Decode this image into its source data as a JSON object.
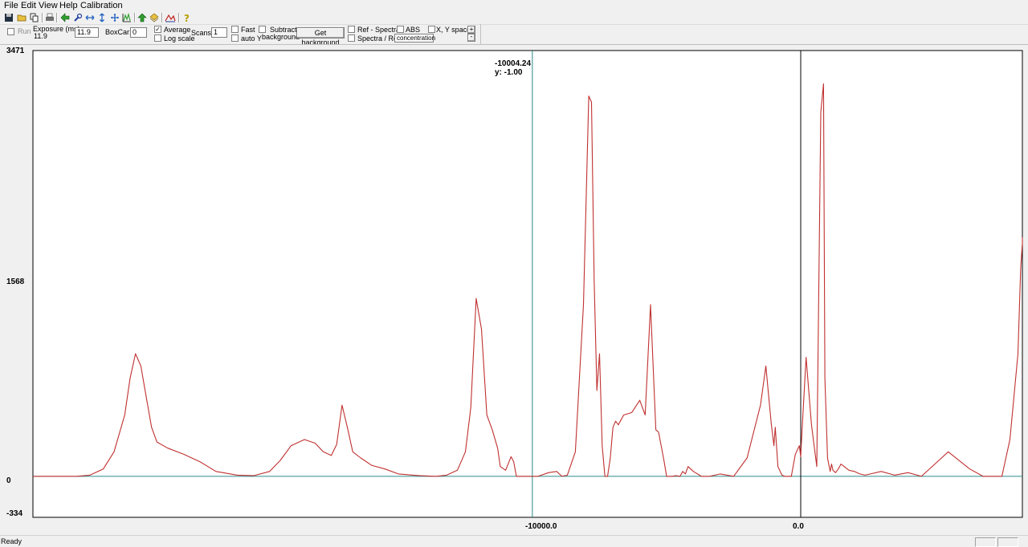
{
  "menubar": {
    "items": [
      "File",
      "Edit",
      "View",
      "Help",
      "Calibration"
    ]
  },
  "toolbar": {
    "icons": [
      "save-icon",
      "open-folder-icon",
      "copy-icon",
      "print-icon",
      "back-arrow-icon",
      "wrench-icon",
      "horizontal-arrows-icon",
      "vertical-arrows-icon",
      "move-icon",
      "peak-chart-icon",
      "up-arrow-icon",
      "stack-icon",
      "spectrum-icon",
      "help-icon"
    ]
  },
  "controls": {
    "run_label": "Run",
    "exposure_label": "Exposure (ms):",
    "exposure_readout": "11.9",
    "exposure_value": "11.9",
    "boxcar_label": "BoxCar:",
    "boxcar_value": "0",
    "average_label": "Average",
    "logscale_label": "Log scale",
    "scans_label": "Scans:",
    "scans_value": "1",
    "fast_label": "Fast",
    "autoy_label": "auto Y",
    "subtract_label": "Subtract",
    "background_label": "background",
    "get_background_label": "Get background",
    "ref_spectra_label": "Ref - Spectra",
    "spectra_ref_label": "Spectra / Ref",
    "abs_label": "ABS",
    "concentration_label": "concentration",
    "xy_space_label": "X, Y space",
    "plus_label": "+",
    "minus_label": "-"
  },
  "plot": {
    "readout_x": "-10004.24",
    "readout_y": "y: -1.00",
    "y_ticks": [
      "3471",
      "1568",
      "0",
      "-334"
    ],
    "x_ticks": [
      "-10000.0",
      "0.0"
    ],
    "curve_color": "#c03030",
    "baseline_color": "#2a8a8a",
    "cursor_color": "#2a8a8a",
    "axis_color": "#000000"
  },
  "chart_data": {
    "type": "line",
    "title": "",
    "xlabel": "",
    "ylabel": "",
    "ylim": [
      -334,
      3471
    ],
    "y_ticks": [
      3471,
      1568,
      0,
      -334
    ],
    "x_ticks": [
      -10000.0,
      0.0
    ],
    "cursor": {
      "x": -10004.24,
      "y": -1.0
    },
    "series": [
      {
        "x": [
          -28700,
          -28000,
          -27000,
          -26500,
          -26000,
          -25600,
          -25200,
          -25000,
          -24800,
          -24600,
          -24400,
          -24200,
          -24000,
          -23600,
          -23000,
          -22400,
          -21800,
          -21000,
          -20400,
          -19800,
          -19400,
          -19000,
          -18500,
          -18100,
          -17800,
          -17500,
          -17300,
          -17100,
          -16900,
          -16700,
          -16400,
          -16000,
          -15500,
          -15000,
          -14200,
          -13600,
          -13200,
          -12800,
          -12500,
          -12300,
          -12100,
          -11900,
          -11700,
          -11500,
          -11300,
          -11200,
          -11000,
          -10800,
          -10700,
          -10600,
          -10400,
          -10300,
          -10200,
          -9800,
          -9400,
          -9100,
          -8900,
          -8700,
          -8400,
          -8100,
          -7900,
          -7800,
          -7700,
          -7600,
          -7500,
          -7400,
          -7300,
          -7200,
          -7100,
          -7000,
          -6900,
          -6800,
          -6600,
          -6300,
          -6000,
          -5800,
          -5600,
          -5400,
          -5300,
          -5100,
          -5000,
          -4800,
          -4650,
          -4500,
          -4400,
          -4300,
          -4200,
          -4000,
          -3700,
          -3400,
          -3000,
          -2500,
          -2000,
          -1500,
          -1300,
          -1100,
          -1000,
          -950,
          -850,
          -700,
          -600,
          -550,
          -500,
          -350,
          -200,
          -50,
          0,
          50,
          200,
          400,
          600,
          750,
          850,
          900,
          1000,
          1100,
          1150,
          1200,
          1300,
          1400,
          1500,
          1800,
          2000,
          2200,
          2400,
          3000,
          3500,
          4000,
          4500,
          5000,
          5500,
          6300,
          6800,
          7000,
          7500,
          7800,
          8100,
          8200,
          8300,
          8350
        ],
        "values": [
          0,
          0,
          0,
          10,
          60,
          200,
          500,
          800,
          1000,
          900,
          650,
          400,
          280,
          230,
          180,
          120,
          40,
          10,
          5,
          40,
          130,
          250,
          300,
          270,
          200,
          170,
          260,
          580,
          400,
          200,
          150,
          90,
          60,
          20,
          5,
          0,
          10,
          50,
          200,
          560,
          1450,
          1200,
          500,
          380,
          230,
          80,
          50,
          160,
          120,
          0,
          0,
          0,
          0,
          0,
          30,
          40,
          0,
          10,
          200,
          1400,
          3100,
          3050,
          1600,
          700,
          1000,
          250,
          0,
          0,
          150,
          400,
          450,
          420,
          500,
          520,
          620,
          500,
          1400,
          380,
          360,
          130,
          0,
          0,
          5,
          0,
          40,
          20,
          80,
          40,
          0,
          0,
          20,
          0,
          150,
          580,
          900,
          430,
          250,
          400,
          80,
          10,
          0,
          0,
          0,
          0,
          180,
          250,
          160,
          380,
          970,
          420,
          80,
          2970,
          3200,
          800,
          150,
          40,
          100,
          50,
          30,
          60,
          100,
          50,
          40,
          20,
          10,
          40,
          10,
          30,
          0,
          100,
          200,
          60,
          0,
          0,
          0,
          300,
          1000,
          1700,
          1900,
          1950
        ]
      }
    ]
  },
  "status": {
    "text": "Ready"
  }
}
